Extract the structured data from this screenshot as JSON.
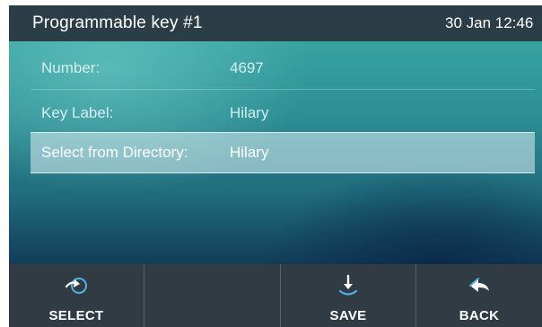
{
  "header": {
    "title": "Programmable key #1",
    "datetime": "30 Jan 12:46"
  },
  "fields": [
    {
      "label": "Number:",
      "value": "4697"
    },
    {
      "label": "Key Label:",
      "value": "Hilary"
    },
    {
      "label": "Select from Directory:",
      "value": "Hilary",
      "selected": true
    }
  ],
  "softkeys": [
    {
      "label": "SELECT",
      "icon": "select-arrow-icon"
    },
    {
      "label": "",
      "icon": ""
    },
    {
      "label": "SAVE",
      "icon": "save-down-arrow-icon"
    },
    {
      "label": "BACK",
      "icon": "back-arrow-icon"
    }
  ],
  "colors": {
    "accent_icon": "#4fb3e6",
    "header_bg": "#2b3d47",
    "softkey_bg": "#303b43"
  }
}
